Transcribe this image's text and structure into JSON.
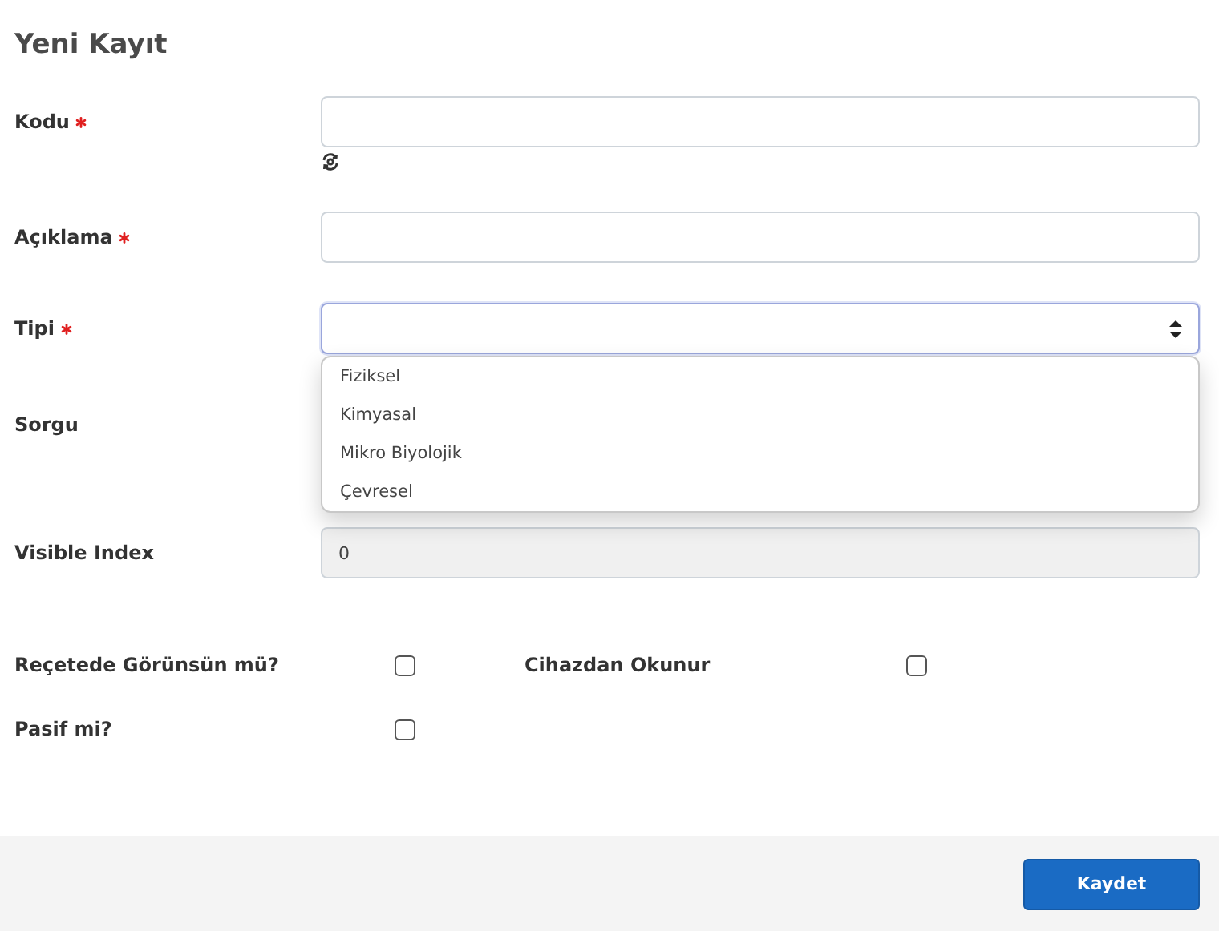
{
  "title": "Yeni Kayıt",
  "fields": [
    {
      "label": "Kodu",
      "required": true,
      "kind": "text",
      "refresh": true
    },
    {
      "label": "Açıklama",
      "required": true,
      "kind": "text"
    },
    {
      "label": "Tipi",
      "required": true,
      "kind": "select",
      "dropdown": {
        "open": true,
        "options": [
          "Fiziksel",
          "Kimyasal",
          "Mikro Biyolojik",
          "Çevresel"
        ]
      }
    },
    {
      "label": "Sorgu",
      "required": false,
      "kind": "covered"
    },
    {
      "label": "Visible Index",
      "required": false,
      "kind": "text",
      "value": "0",
      "disabled": true
    }
  ],
  "checks": [
    {
      "label": "Reçetede Görünsün mü?",
      "checked": false
    },
    {
      "label": "Cihazdan Okunur",
      "checked": false
    },
    {
      "label": "Pasif mi?",
      "checked": false
    }
  ],
  "save_button": "Kaydet"
}
